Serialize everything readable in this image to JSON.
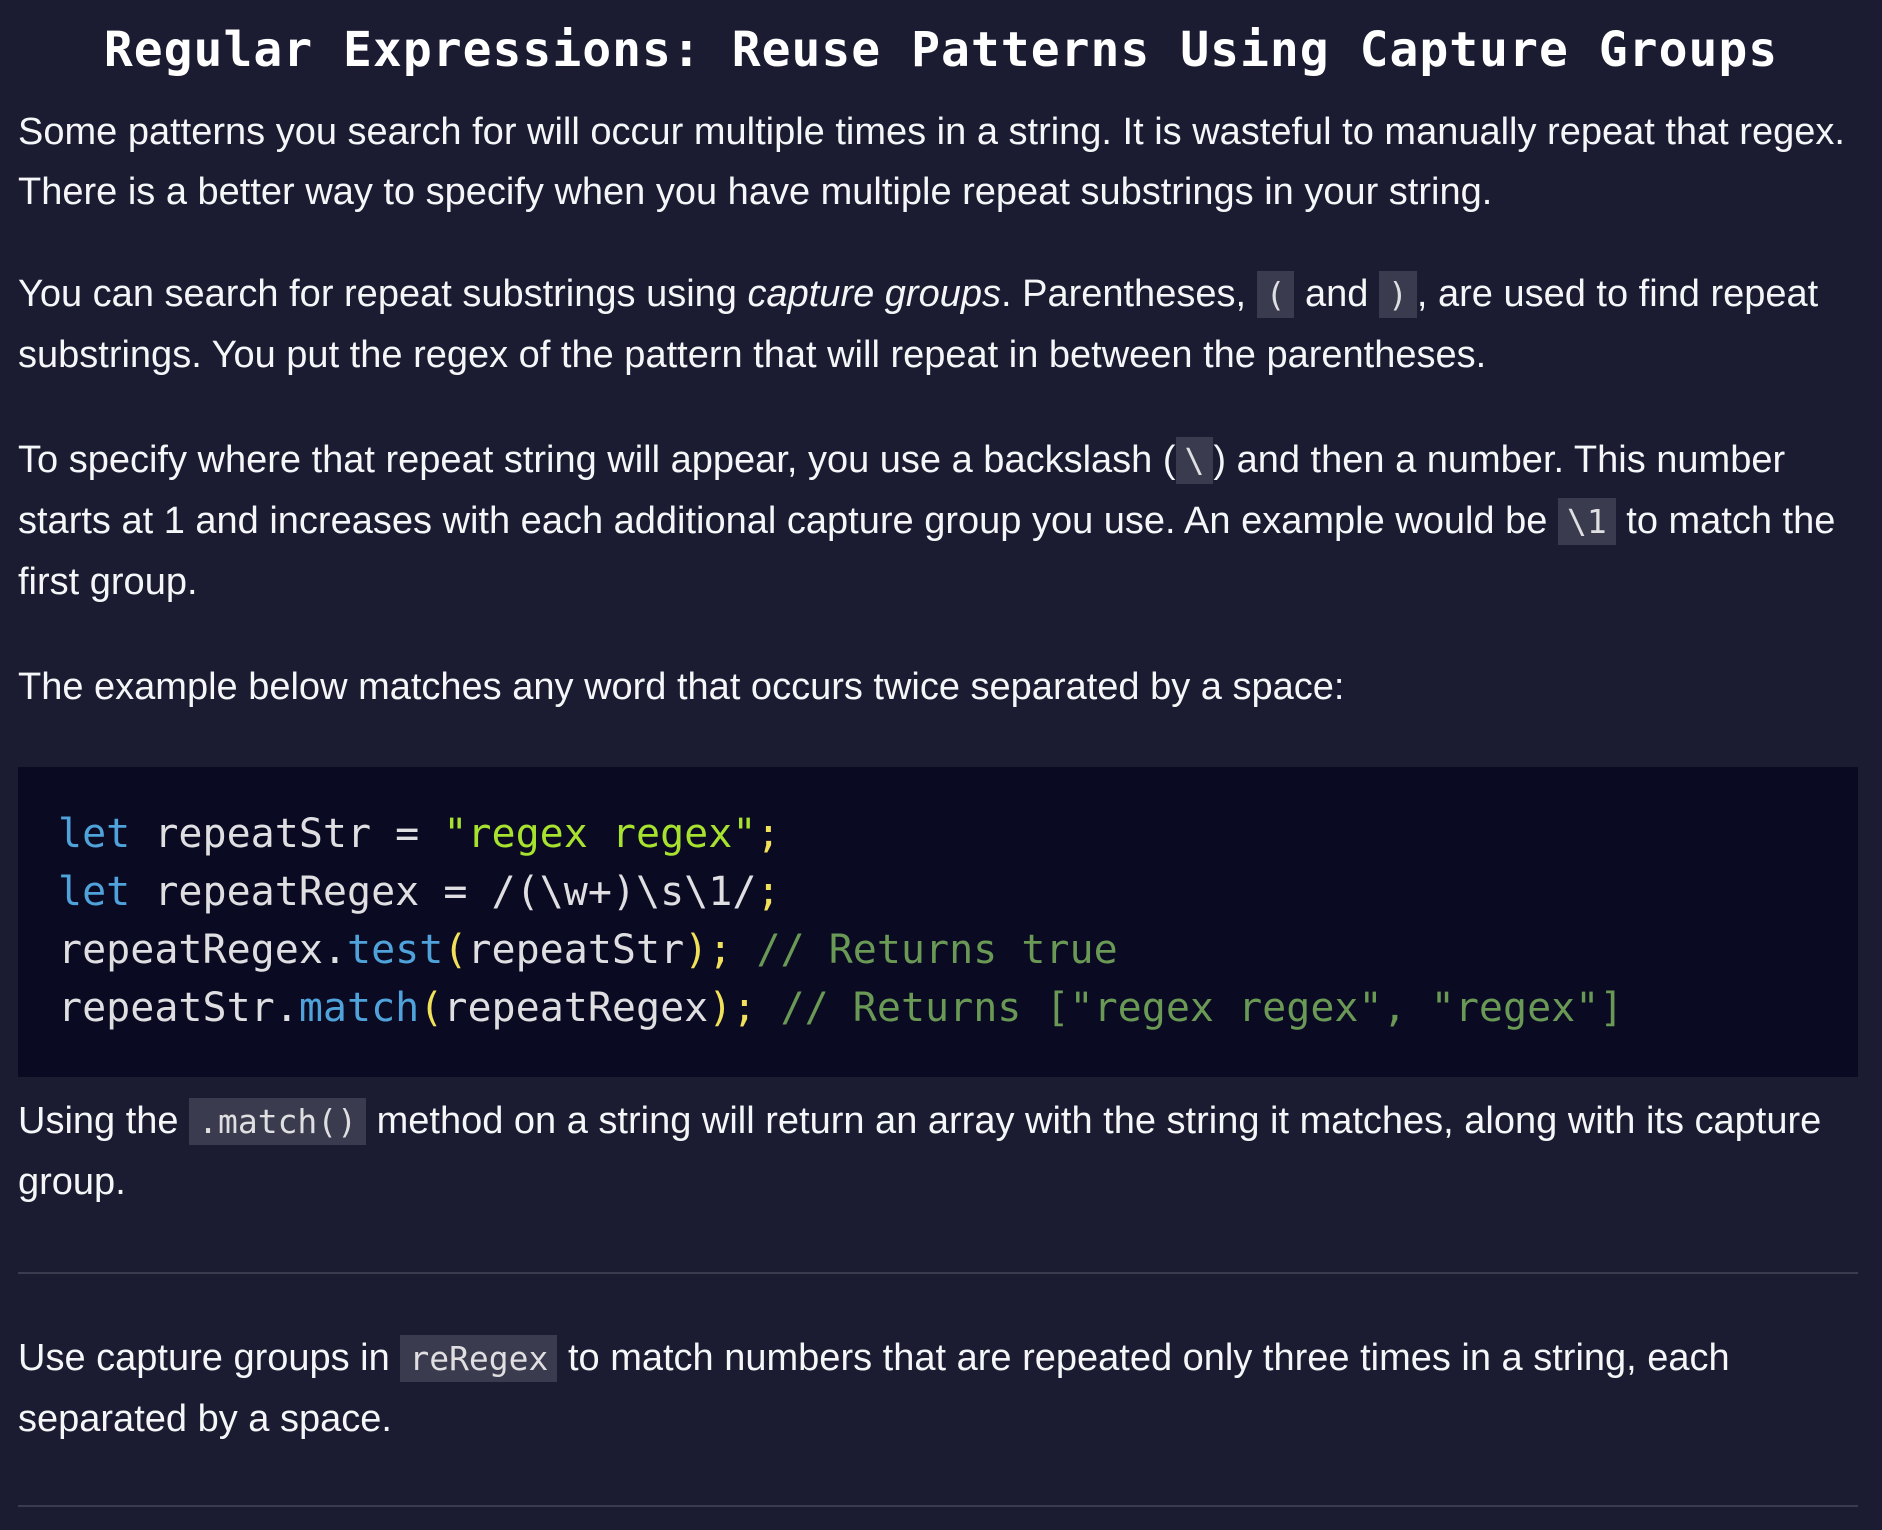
{
  "challenge": {
    "title": "Regular Expressions: Reuse Patterns Using Capture Groups"
  },
  "paragraphs": {
    "p1": "Some patterns you search for will occur multiple times in a string. It is wasteful to manually repeat that regex. There is a better way to specify when you have multiple repeat substrings in your string.",
    "p2": {
      "text_before": "You can search for repeat substrings using ",
      "emphasis": "capture groups",
      "text_after_emphasis": ". Parentheses, ",
      "code_open_paren": "(",
      "and": " and ",
      "code_close_paren": ")",
      "text_end": ", are used to find repeat substrings. You put the regex of the pattern that will repeat in between the parentheses."
    },
    "p3": {
      "text_before": "To specify where that repeat string will appear, you use a backslash (",
      "code_backslash": "\\",
      "text_middle": ") and then a number. This number starts at 1 and increases with each additional capture group you use. An example would be ",
      "code_backref": "\\1",
      "text_end": " to match the first group."
    },
    "p4": "The example below matches any word that occurs twice separated by a space:",
    "p5": {
      "text_before": "Using the ",
      "code_method": ".match()",
      "text_end": " method on a string will return an array with the string it matches, along with its capture group."
    },
    "p6": {
      "text_before": "Use capture groups in ",
      "code_var": "reRegex",
      "text_end": " to match numbers that are repeated only three times in a string, each separated by a space."
    }
  },
  "code_example": {
    "line1": {
      "kw": "let",
      "ident": " repeatStr ",
      "op": "=",
      "sp": " ",
      "str": "\"regex regex\"",
      "semi": ";"
    },
    "line2": {
      "kw": "let",
      "ident": " repeatRegex ",
      "op": "=",
      "sp": " ",
      "regex": "/(\\w+)\\s\\1/",
      "semi": ";"
    },
    "line3": {
      "obj": "repeatRegex",
      "dot": ".",
      "method": "test",
      "lparen": "(",
      "arg": "repeatStr",
      "rparen": ")",
      "semi": ";",
      "comment": " // Returns true"
    },
    "line4": {
      "obj": "repeatStr",
      "dot": ".",
      "method": "match",
      "lparen": "(",
      "arg": "repeatRegex",
      "rparen": ")",
      "semi": ";",
      "comment": " // Returns [\"regex regex\", \"regex\"]"
    }
  },
  "colors": {
    "background": "#1b1b32",
    "code_background": "#0a0a23",
    "inline_code_background": "#3b3b4f",
    "keyword": "#4fa3da",
    "string": "#a6e22e",
    "comment": "#6a9955",
    "punctuation": "#f1e05a"
  }
}
